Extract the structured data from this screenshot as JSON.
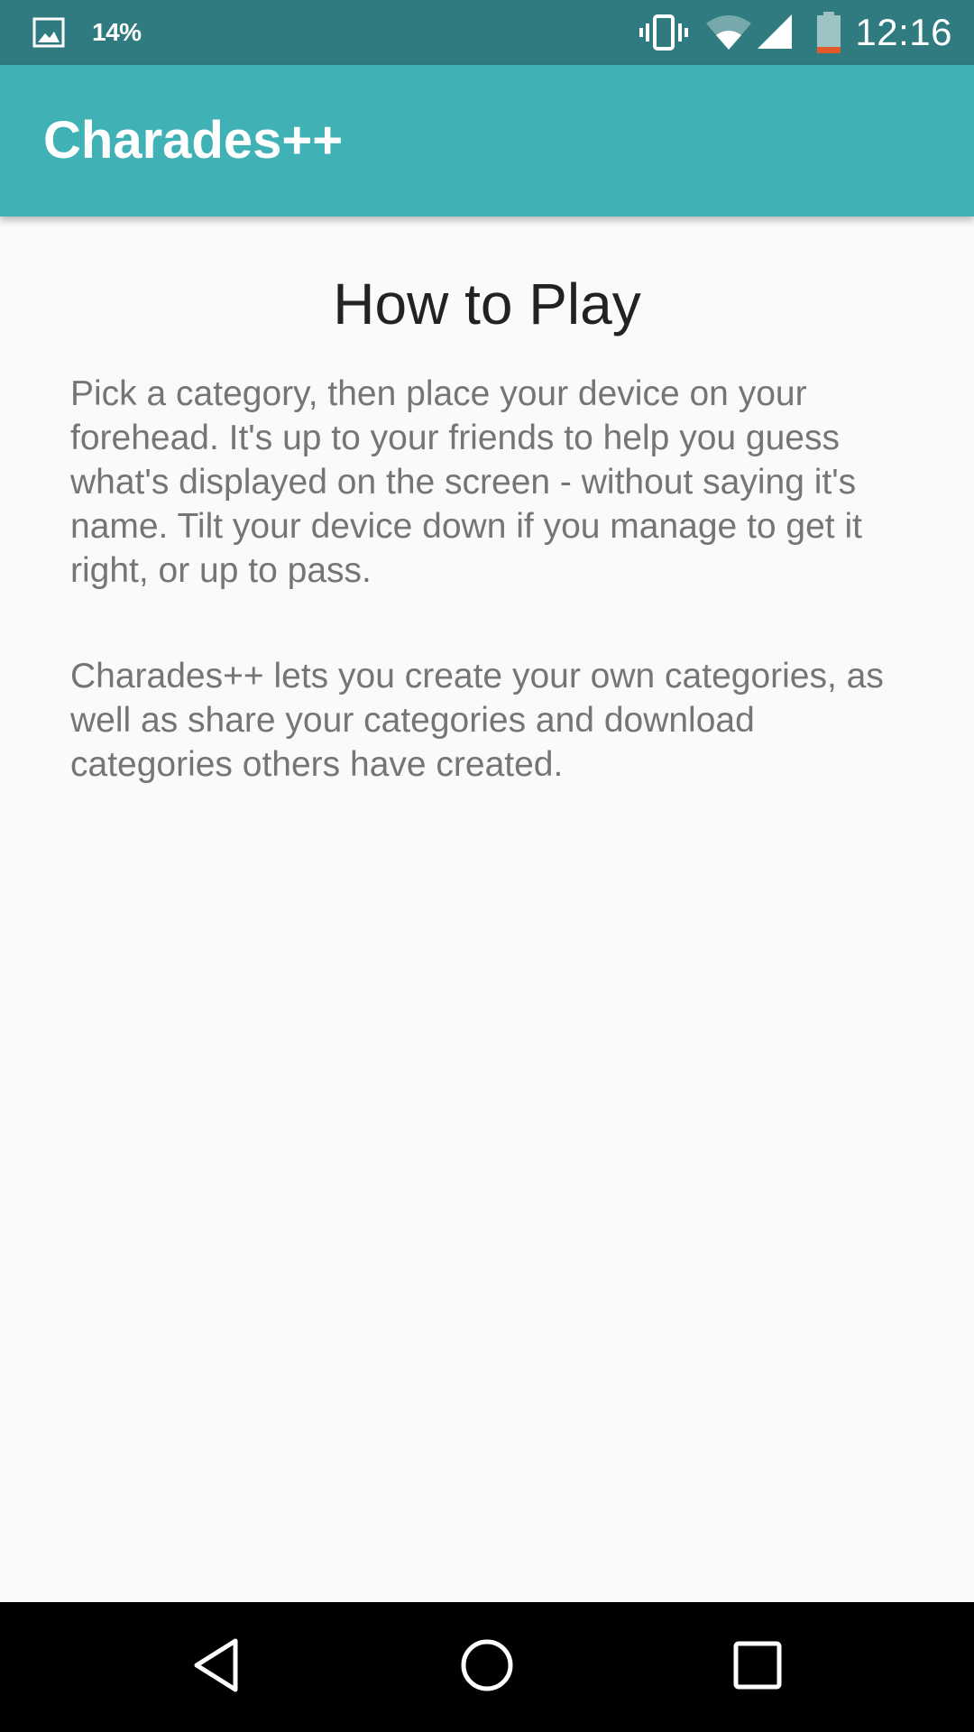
{
  "status_bar": {
    "battery_percent": "14%",
    "clock": "12:16",
    "background_color": "#2f7b80",
    "icons": [
      "gallery-icon",
      "vibrate-icon",
      "wifi-icon",
      "signal-icon",
      "battery-icon"
    ]
  },
  "app_bar": {
    "title": "Charades++",
    "background_color": "#40b1b5"
  },
  "content": {
    "heading": "How to Play",
    "paragraphs": [
      "Pick a category, then place your device on your forehead. It's up to your friends to help you guess what's displayed on the screen - without saying it's name. Tilt your device down if you manage to get it right, or up to pass.",
      "Charades++ lets you create your own categories, as well as share your categories and download categories others have created."
    ]
  },
  "nav_bar": {
    "buttons": [
      "back-icon",
      "home-icon",
      "recents-icon"
    ]
  }
}
